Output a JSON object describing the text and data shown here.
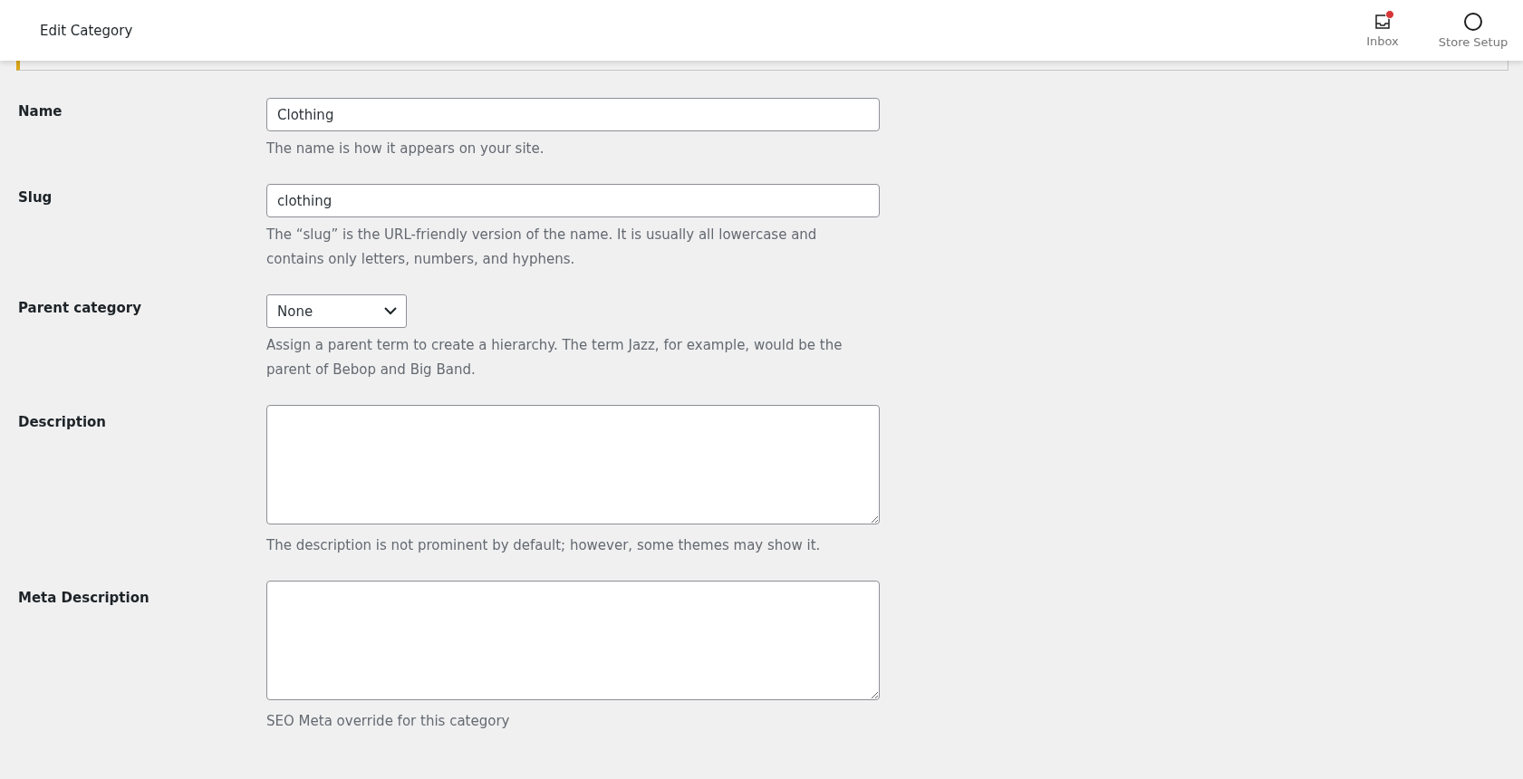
{
  "header": {
    "title": "Edit Category",
    "actions": [
      {
        "kind": "inbox",
        "label": "Inbox",
        "badge": true
      },
      {
        "kind": "setup",
        "label": "Store Setup",
        "badge": false
      }
    ]
  },
  "fields": [
    {
      "kind": "text",
      "label": "Name",
      "value": "Clothing",
      "help": "The name is how it appears on your site."
    },
    {
      "kind": "text",
      "label": "Slug",
      "value": "clothing",
      "help": "The “slug” is the URL-friendly version of the name. It is usually all lowercase and contains only letters, numbers, and hyphens."
    },
    {
      "kind": "select",
      "label": "Parent category",
      "value": "None",
      "help": "Assign a parent term to create a hierarchy. The term Jazz, for example, would be the parent of Bebop and Big Band."
    },
    {
      "kind": "textarea",
      "label": "Description",
      "help": "The description is not prominent by default; however, some themes may show it."
    },
    {
      "kind": "textarea",
      "label": "Meta Description",
      "help": "SEO Meta override for this category"
    }
  ]
}
